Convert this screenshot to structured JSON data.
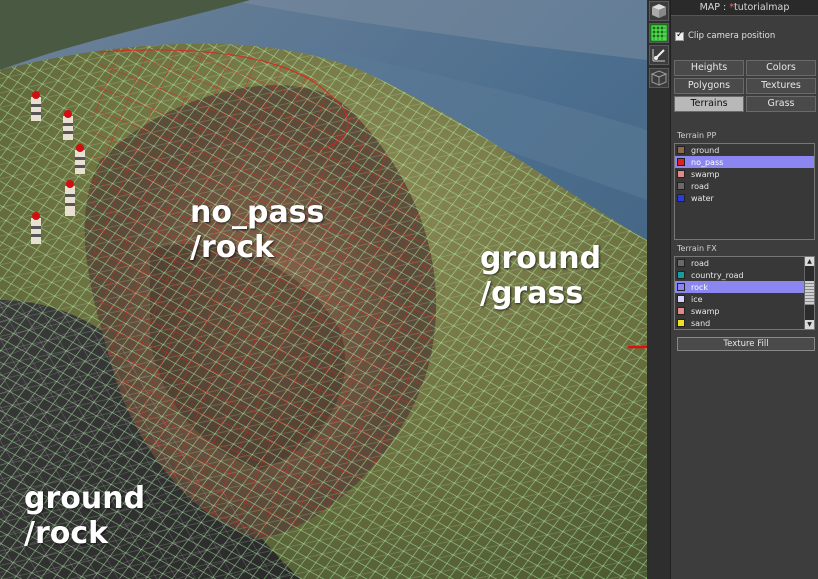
{
  "viewport": {
    "labels": {
      "no_pass_rock": "no_pass\n/rock",
      "ground_grass": "ground\n/grass",
      "ground_rock": "ground\n/rock"
    }
  },
  "toolstrip": {
    "icons": [
      "cube-icon",
      "grid-icon",
      "brush-icon",
      "wire-cube-icon"
    ]
  },
  "panel": {
    "map_prefix": "MAP : ",
    "map_modified_marker": "*",
    "map_name": "tutorialmap",
    "clip_camera_label": "Clip camera position",
    "clip_camera_checked": true,
    "tabs": [
      {
        "label": "Heights",
        "active": false
      },
      {
        "label": "Colors",
        "active": false
      },
      {
        "label": "Polygons",
        "active": false
      },
      {
        "label": "Textures",
        "active": false
      },
      {
        "label": "Terrains",
        "active": true
      },
      {
        "label": "Grass",
        "active": false
      }
    ],
    "terrain_pp": {
      "title": "Terrain PP",
      "items": [
        {
          "label": "ground",
          "color": "#8a6a4a",
          "selected": false
        },
        {
          "label": "no_pass",
          "color": "#e02020",
          "selected": true
        },
        {
          "label": "swamp",
          "color": "#e08a8a",
          "selected": false
        },
        {
          "label": "road",
          "color": "#6a6a6a",
          "selected": false
        },
        {
          "label": "water",
          "color": "#2a3ae0",
          "selected": false
        }
      ]
    },
    "terrain_fx": {
      "title": "Terrain FX",
      "items": [
        {
          "label": "road",
          "color": "#6a6a6a",
          "selected": false
        },
        {
          "label": "country_road",
          "color": "#1a9a9a",
          "selected": false
        },
        {
          "label": "rock",
          "color": "#8c86f0",
          "selected": true
        },
        {
          "label": "ice",
          "color": "#d8d0ff",
          "selected": false
        },
        {
          "label": "swamp",
          "color": "#e08a8a",
          "selected": false
        },
        {
          "label": "sand",
          "color": "#f0e020",
          "selected": false
        }
      ]
    },
    "texture_fill_label": "Texture Fill"
  },
  "colors": {
    "accent_selection": "#8c86f0",
    "annotation_arrow": "#e01010"
  }
}
